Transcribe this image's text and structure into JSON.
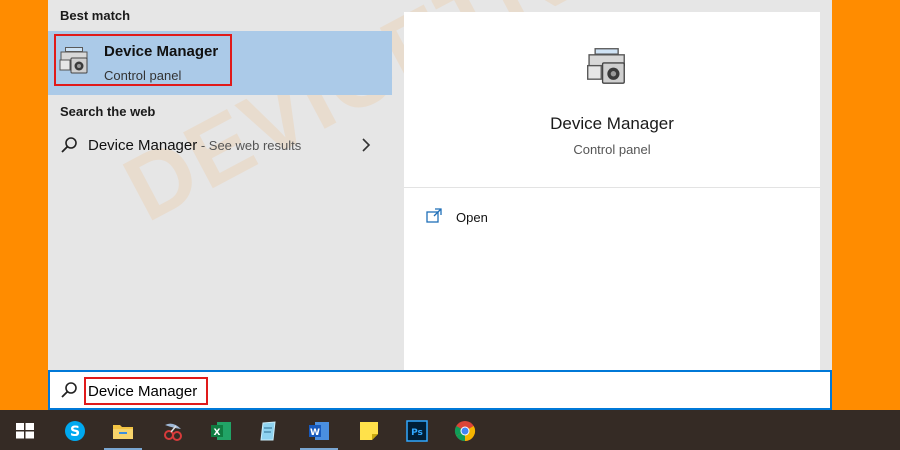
{
  "results": {
    "best_match_label": "Best match",
    "best_match": {
      "title": "Device Manager",
      "subtitle": "Control panel",
      "icon": "device-manager-icon"
    },
    "search_web_label": "Search the web",
    "web_result": {
      "title": "Device Manager",
      "suffix": " - See web results",
      "icon": "search-icon"
    }
  },
  "detail": {
    "title": "Device Manager",
    "subtitle": "Control panel",
    "icon": "device-manager-icon",
    "actions": [
      {
        "label": "Open",
        "icon": "open-window-icon"
      }
    ]
  },
  "search_box": {
    "value": "Device Manager",
    "icon": "search-icon"
  },
  "watermark": "DEVICETRICKS",
  "taskbar": {
    "items": [
      {
        "name": "windows-start",
        "icon": "windows-logo-icon"
      },
      {
        "name": "skype",
        "icon": "skype-icon"
      },
      {
        "name": "file-explorer",
        "icon": "folder-icon"
      },
      {
        "name": "snipping-tool",
        "icon": "scissors-icon"
      },
      {
        "name": "excel",
        "icon": "excel-icon"
      },
      {
        "name": "notepad",
        "icon": "notepad-icon"
      },
      {
        "name": "word",
        "icon": "word-icon"
      },
      {
        "name": "sticky-notes",
        "icon": "sticky-note-icon"
      },
      {
        "name": "photoshop",
        "icon": "photoshop-icon"
      },
      {
        "name": "chrome",
        "icon": "chrome-icon"
      }
    ]
  },
  "colors": {
    "background": "#ff8c00",
    "selection": "#abcae8",
    "highlight_border": "#e01a1a",
    "search_border": "#0078d7",
    "taskbar": "#352b25"
  }
}
